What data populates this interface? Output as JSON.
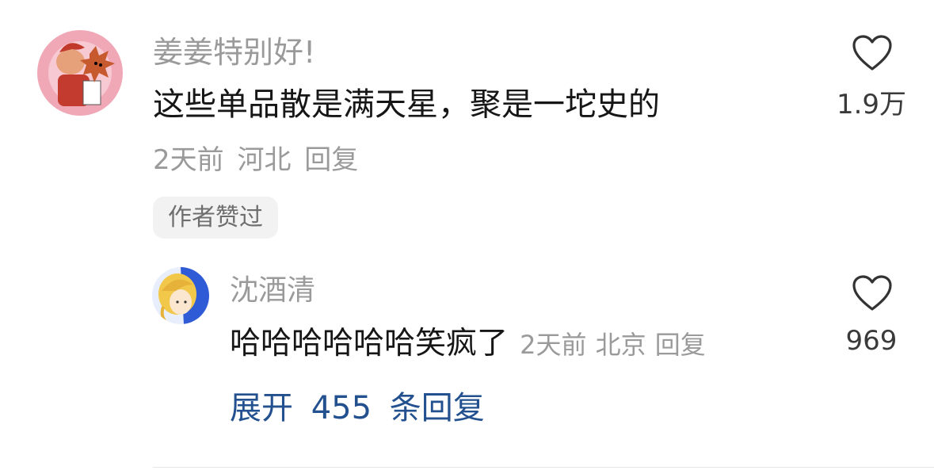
{
  "comment": {
    "username": "姜姜特别好!",
    "text": "这些单品散是满天星，聚是一坨史的",
    "time": "2天前",
    "location": "河北",
    "reply_label": "回复",
    "badge": "作者赞过",
    "likes": "1.9万"
  },
  "reply": {
    "username": "沈酒清",
    "text": "哈哈哈哈哈哈笑疯了",
    "time": "2天前",
    "location": "北京",
    "reply_label": "回复",
    "likes": "969"
  },
  "expand": {
    "prefix": "展开",
    "count": "455",
    "suffix": "条回复"
  },
  "colors": {
    "name": "#9a9a9a",
    "text": "#161616",
    "link": "#23508f",
    "badge_bg": "#f2f2f2"
  },
  "icons": {
    "like": "heart-outline-icon"
  }
}
